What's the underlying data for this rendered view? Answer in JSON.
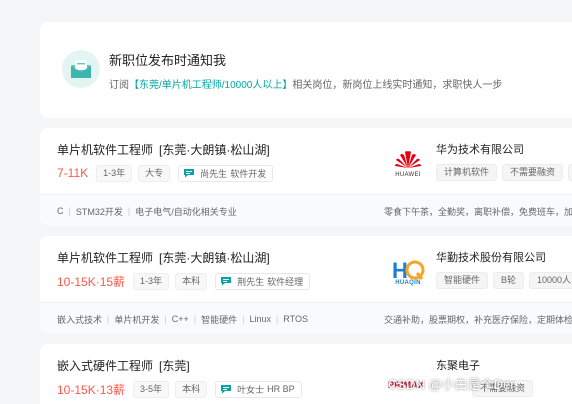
{
  "subscribe": {
    "title": "新职位发布时通知我",
    "desc_prefix": "订阅",
    "desc_highlight": "【东莞/单片机工程师/10000人以上】",
    "desc_suffix": "相关岗位，新岗位上线实时通知，求职快人一步"
  },
  "jobs": [
    {
      "title": "单片机软件工程师",
      "location": "[东莞·大朗镇·松山湖]",
      "salary": "7-11K",
      "tags": [
        "1-3年",
        "大专"
      ],
      "recruiter_name": "尚先生",
      "recruiter_role": "软件开发",
      "skills": [
        "C",
        "STM32开发",
        "电子电气/自动化相关专业"
      ],
      "welfare": "零食下午茶，全勤奖，离职补偿，免费班车，加",
      "company": "华为技术有限公司",
      "company_tags": [
        "计算机软件",
        "不需要融资",
        "1"
      ],
      "logo_text": "HUAWEI"
    },
    {
      "title": "单片机软件工程师",
      "location": "[东莞·大朗镇·松山湖]",
      "salary": "10-15K·15薪",
      "tags": [
        "1-3年",
        "本科"
      ],
      "recruiter_name": "荆先生",
      "recruiter_role": "软件经理",
      "skills": [
        "嵌入式技术",
        "单片机开发",
        "C++",
        "智能硬件",
        "Linux",
        "RTOS"
      ],
      "welfare": "交通补助，股票期权，补充医疗保险，定期体检",
      "company": "华勤技术股份有限公司",
      "company_tags": [
        "智能硬件",
        "B轮",
        "10000人以上"
      ],
      "logo_text": "HUAQIN"
    },
    {
      "title": "嵌入式硬件工程师",
      "location": "[东莞]",
      "salary": "10-15K·13薪",
      "tags": [
        "3-5年",
        "本科"
      ],
      "recruiter_name": "叶女士",
      "recruiter_role": "HR BP",
      "company": "东聚电子",
      "company_tags": [
        "",
        "不需要融资",
        ""
      ],
      "logo_text": "PRIMAX"
    }
  ],
  "watermark": "CSDN @小白是个Der",
  "colors": {
    "accent": "#00a6a7",
    "salary": "#fe574a",
    "huawei_red": "#e60012",
    "huaqin_blue": "#1e7fd0"
  }
}
